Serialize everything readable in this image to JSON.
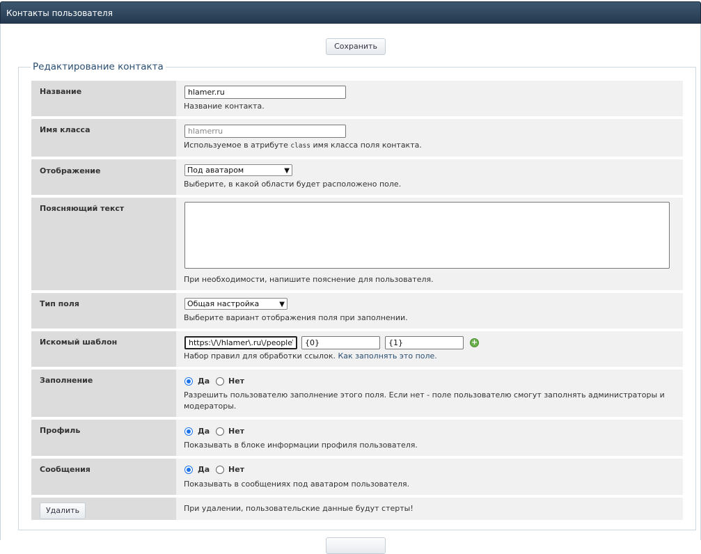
{
  "window": {
    "title": "Контакты пользователя"
  },
  "toolbar": {
    "save_label": "Сохранить"
  },
  "form": {
    "legend": "Редактирование контакта",
    "name": {
      "label": "Название",
      "value": "hlamer.ru",
      "hint": "Название контакта."
    },
    "class_name": {
      "label": "Имя класса",
      "placeholder": "hlamerru",
      "hint_before": "Используемое в атрибуте",
      "hint_code": "class",
      "hint_after": "имя класса поля контакта."
    },
    "display": {
      "label": "Отображение",
      "selected": "Под аватаром",
      "hint": "Выберите, в какой области будет расположено поле."
    },
    "explain": {
      "label": "Поясняющий текст",
      "value": "",
      "hint": "При необходимости, напишите пояснение для пользователя."
    },
    "field_type": {
      "label": "Тип поля",
      "selected": "Общая настройка",
      "hint": "Выберите вариант отображения поля при заполнении."
    },
    "pattern": {
      "label": "Искомый шаблон",
      "regex": "https:\\/\\/hlamer\\.ru\\/people\\/(\\d",
      "repl0": "{0}",
      "repl1": "{1}",
      "hint": "Набор правил для обработки ссылок.",
      "link": "Как заполнять это поле."
    },
    "filling": {
      "label": "Заполнение",
      "yes": "Да",
      "no": "Нет",
      "hint_line1": "Разрешить пользователю заполнение этого поля. Если нет - поле пользователю смогут заполнять администраторы и",
      "hint_line2": "модераторы."
    },
    "profile": {
      "label": "Профиль",
      "yes": "Да",
      "no": "Нет",
      "hint": "Показывать в блоке информации профиля пользователя."
    },
    "messages": {
      "label": "Сообщения",
      "yes": "Да",
      "no": "Нет",
      "hint": "Показывать в сообщениях под аватаром пользователя."
    },
    "delete": {
      "button": "Удалить",
      "hint": "При удалении, пользовательские данные будут стерты!"
    }
  },
  "colors": {
    "titlebar": "#2f4862",
    "accent": "#2a4e72",
    "radio": "#1a73e8",
    "add": "#6ab04c"
  }
}
